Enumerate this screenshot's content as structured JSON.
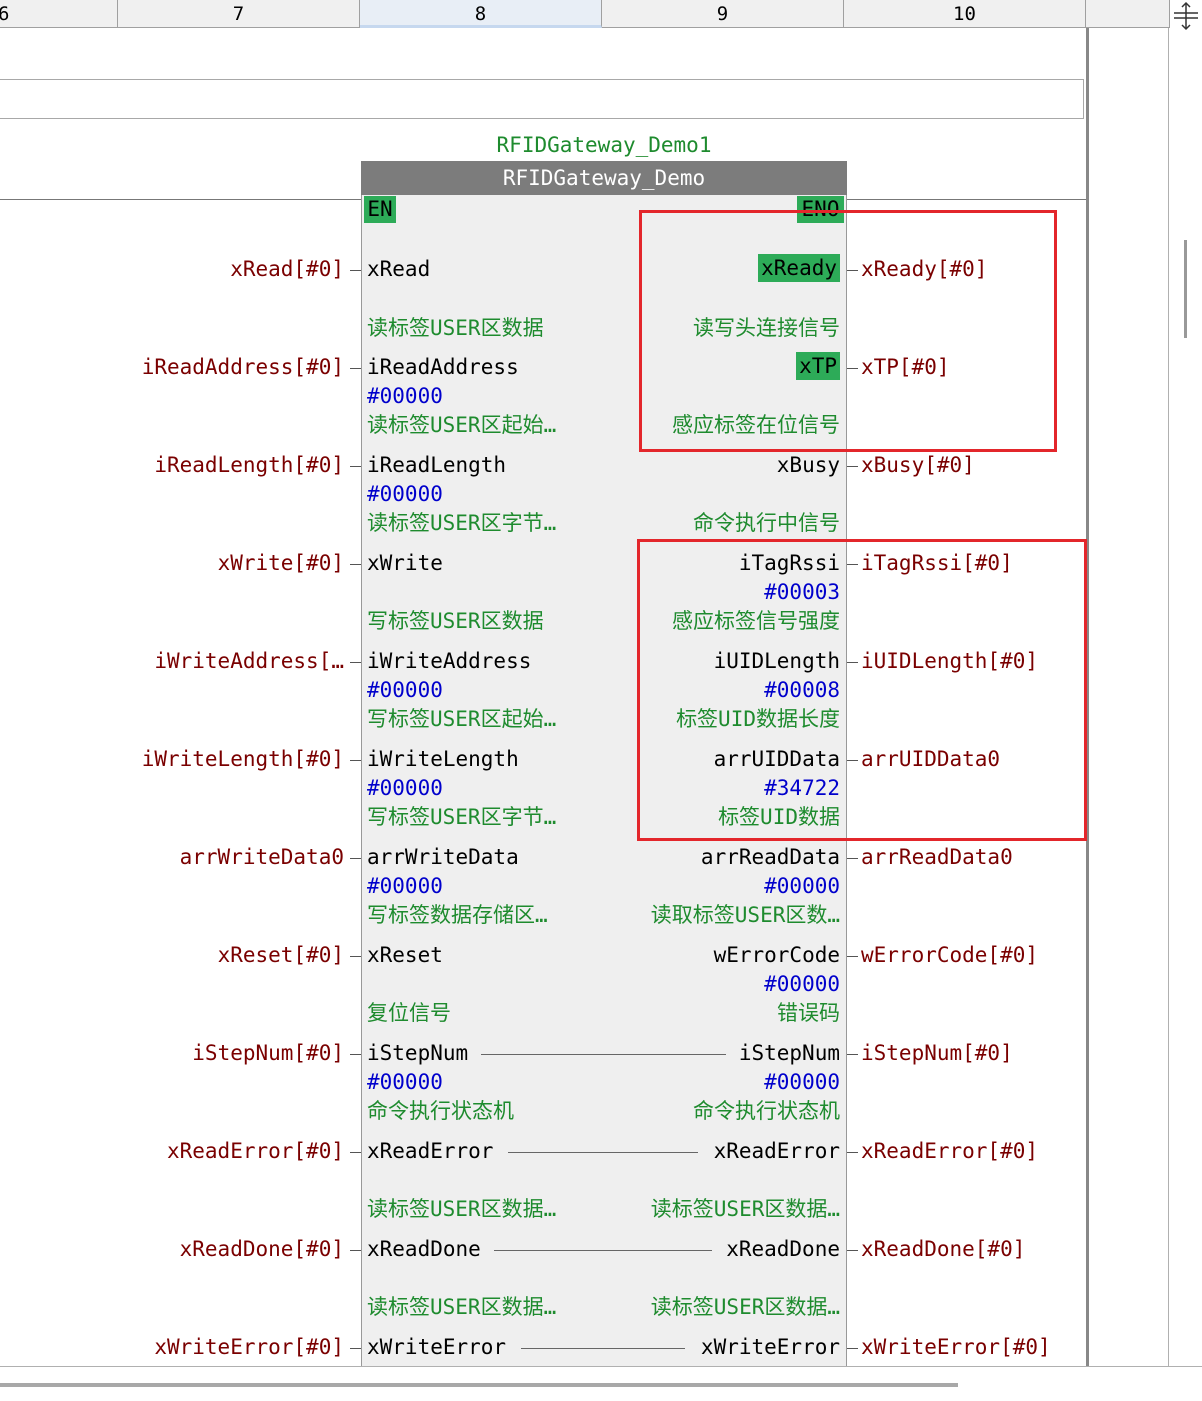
{
  "columns": [
    "6",
    "7",
    "8",
    "9",
    "10"
  ],
  "block": {
    "instance_name": "RFIDGateway_Demo1",
    "type_name": "RFIDGateway_Demo",
    "en_label": "EN",
    "eno_label": "ENO"
  },
  "rows": [
    {
      "in_var": "xRead[#0]",
      "in_pin": "xRead",
      "in_val": "",
      "in_cmt": "读标签USER区数据",
      "out_pin": "xReady",
      "out_val": "",
      "out_cmt": "读写头连接信号",
      "out_var": "xReady[#0]"
    },
    {
      "in_var": "iReadAddress[#0]",
      "in_pin": "iReadAddress",
      "in_val": "#00000",
      "in_cmt": "读标签USER区起始…",
      "out_pin": "xTP",
      "out_val": "",
      "out_cmt": "感应标签在位信号",
      "out_var": "xTP[#0]"
    },
    {
      "in_var": "iReadLength[#0]",
      "in_pin": "iReadLength",
      "in_val": "#00000",
      "in_cmt": "读标签USER区字节…",
      "out_pin": "xBusy",
      "out_val": "",
      "out_cmt": "命令执行中信号",
      "out_var": "xBusy[#0]"
    },
    {
      "in_var": "xWrite[#0]",
      "in_pin": "xWrite",
      "in_val": "",
      "in_cmt": "写标签USER区数据",
      "out_pin": "iTagRssi",
      "out_val": "#00003",
      "out_cmt": "感应标签信号强度",
      "out_var": "iTagRssi[#0]"
    },
    {
      "in_var": "iWriteAddress[…",
      "in_pin": "iWriteAddress",
      "in_val": "#00000",
      "in_cmt": "写标签USER区起始…",
      "out_pin": "iUIDLength",
      "out_val": "#00008",
      "out_cmt": "标签UID数据长度",
      "out_var": "iUIDLength[#0]"
    },
    {
      "in_var": "iWriteLength[#0]",
      "in_pin": "iWriteLength",
      "in_val": "#00000",
      "in_cmt": "写标签USER区字节…",
      "out_pin": "arrUIDData",
      "out_val": "#34722",
      "out_cmt": "标签UID数据",
      "out_var": "arrUIDData0"
    },
    {
      "in_var": "arrWriteData0",
      "in_pin": "arrWriteData",
      "in_val": "#00000",
      "in_cmt": "写标签数据存储区…",
      "out_pin": "arrReadData",
      "out_val": "#00000",
      "out_cmt": "读取标签USER区数…",
      "out_var": "arrReadData0"
    },
    {
      "in_var": "xReset[#0]",
      "in_pin": "xReset",
      "in_val": "",
      "in_cmt": "复位信号",
      "out_pin": "wErrorCode",
      "out_val": "#00000",
      "out_cmt": "错误码",
      "out_var": "wErrorCode[#0]"
    },
    {
      "in_var": "iStepNum[#0]",
      "in_pin": "iStepNum",
      "in_val": "#00000",
      "in_cmt": "命令执行状态机",
      "out_pin": "iStepNum",
      "out_val": "#00000",
      "out_cmt": "命令执行状态机",
      "out_var": "iStepNum[#0]"
    },
    {
      "in_var": "xReadError[#0]",
      "in_pin": "xReadError",
      "in_val": "",
      "in_cmt": "读标签USER区数据…",
      "out_pin": "xReadError",
      "out_val": "",
      "out_cmt": "读标签USER区数据…",
      "out_var": "xReadError[#0]"
    },
    {
      "in_var": "xReadDone[#0]",
      "in_pin": "xReadDone",
      "in_val": "",
      "in_cmt": "读标签USER区数据…",
      "out_pin": "xReadDone",
      "out_val": "",
      "out_cmt": "读标签USER区数据…",
      "out_var": "xReadDone[#0]"
    },
    {
      "in_var": "xWriteError[#0]",
      "in_pin": "xWriteError",
      "in_val": "",
      "in_cmt": "",
      "out_pin": "xWriteError",
      "out_val": "",
      "out_cmt": "",
      "out_var": "xWriteError[#0]"
    }
  ],
  "highlighted_pins": [
    "xReady",
    "xTP"
  ],
  "passthrough_rows": [
    8,
    9,
    10,
    11
  ],
  "colors": {
    "accent_green": "#2dab58",
    "annotation_red": "#e3262b",
    "variable_color": "#7a0000",
    "value_color": "#0000cc",
    "comment_color": "#1e8b2e"
  }
}
